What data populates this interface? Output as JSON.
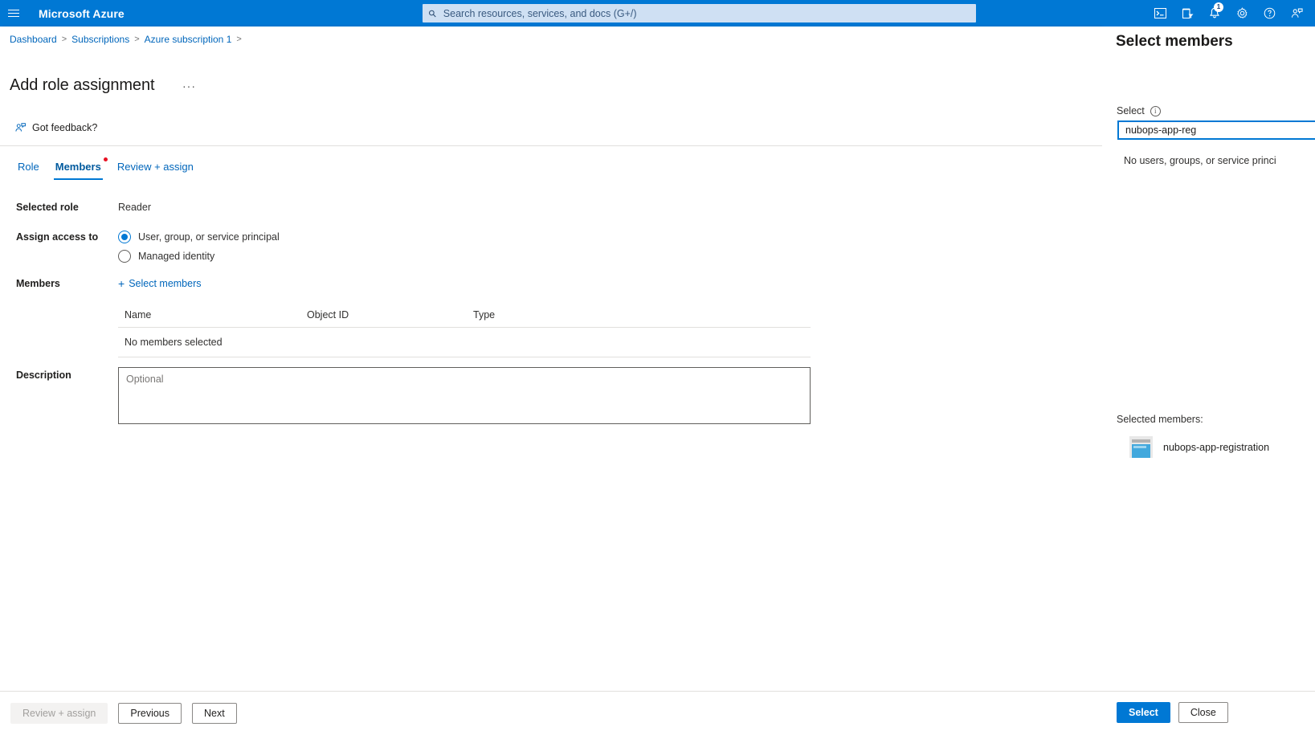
{
  "topnav": {
    "menu_icon": "hamburger-icon",
    "brand": "Microsoft Azure",
    "search_placeholder": "Search resources, services, and docs (G+/)",
    "search_value": "",
    "icons": [
      {
        "name": "cloud-shell-icon",
        "label": "Cloud Shell"
      },
      {
        "name": "directory-filter-icon",
        "label": "Directories + subscriptions"
      },
      {
        "name": "notifications-bell-icon",
        "label": "Notifications",
        "badge": "1"
      },
      {
        "name": "settings-gear-icon",
        "label": "Settings"
      },
      {
        "name": "help-question-icon",
        "label": "Help"
      },
      {
        "name": "feedback-person-icon",
        "label": "Feedback"
      }
    ]
  },
  "breadcrumb": {
    "items": [
      "Dashboard",
      "Subscriptions",
      "Azure subscription 1"
    ],
    "separator": ">"
  },
  "page": {
    "title": "Add role assignment",
    "ellipsis": "···",
    "feedback_label": "Got feedback?"
  },
  "tabs": [
    {
      "label": "Role",
      "active": false,
      "dot": false
    },
    {
      "label": "Members",
      "active": true,
      "dot": true
    },
    {
      "label": "Review + assign",
      "active": false,
      "dot": false
    }
  ],
  "form": {
    "selected_role_label": "Selected role",
    "selected_role_value": "Reader",
    "assign_access_label": "Assign access to",
    "assign_options": [
      {
        "label": "User, group, or service principal",
        "checked": true
      },
      {
        "label": "Managed identity",
        "checked": false
      }
    ],
    "members_label": "Members",
    "select_members_link": "Select members",
    "select_members_plus": "+",
    "description_label": "Description",
    "description_placeholder": "Optional",
    "description_value": ""
  },
  "members_table": {
    "columns": [
      "Name",
      "Object ID",
      "Type"
    ],
    "empty_text": "No members selected",
    "rows": []
  },
  "main_footer": {
    "review_assign": "Review + assign",
    "previous": "Previous",
    "next": "Next"
  },
  "blade": {
    "title": "Select members",
    "select_label": "Select",
    "info_glyph": "i",
    "search_value": "nubops-app-reg",
    "no_results": "No users, groups, or service princi",
    "selected_members_label": "Selected members:",
    "selected": [
      {
        "name": "nubops-app-registration",
        "icon": "app-registration-avatar"
      }
    ],
    "select_button": "Select",
    "close_button": "Close"
  },
  "colors": {
    "azure_blue": "#0078d4",
    "header_blue": "#0078d4",
    "link_blue": "#0066bb",
    "red_dot": "#e81123"
  }
}
